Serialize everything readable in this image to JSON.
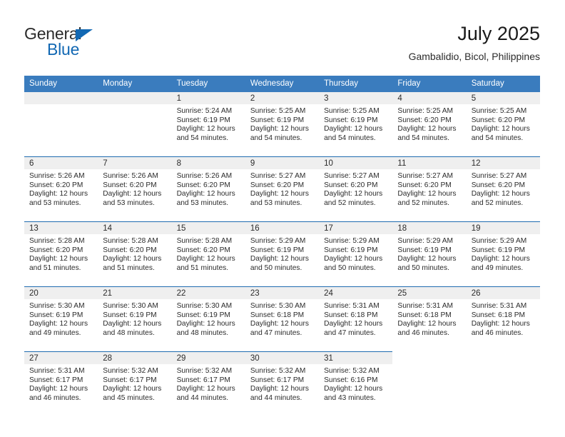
{
  "brand": {
    "word_one": "General",
    "word_two": "Blue",
    "triangle_icon": "triangle-right-icon",
    "color": "#1268b3"
  },
  "header": {
    "title": "July 2025",
    "subtitle": "Gambalidio, Bicol, Philippines"
  },
  "theme": {
    "header_blue": "#3a7cbe",
    "row_divider_blue": "#1f6cb0",
    "daynum_band_gray": "#efefef",
    "text_color": "#2b2b2b"
  },
  "calendar": {
    "weekday_headers": [
      "Sunday",
      "Monday",
      "Tuesday",
      "Wednesday",
      "Thursday",
      "Friday",
      "Saturday"
    ],
    "weeks": [
      [
        {
          "day": "",
          "empty": true
        },
        {
          "day": "",
          "empty": true
        },
        {
          "day": "1",
          "sunrise": "Sunrise: 5:24 AM",
          "sunset": "Sunset: 6:19 PM",
          "daylight": "Daylight: 12 hours and 54 minutes."
        },
        {
          "day": "2",
          "sunrise": "Sunrise: 5:25 AM",
          "sunset": "Sunset: 6:19 PM",
          "daylight": "Daylight: 12 hours and 54 minutes."
        },
        {
          "day": "3",
          "sunrise": "Sunrise: 5:25 AM",
          "sunset": "Sunset: 6:19 PM",
          "daylight": "Daylight: 12 hours and 54 minutes."
        },
        {
          "day": "4",
          "sunrise": "Sunrise: 5:25 AM",
          "sunset": "Sunset: 6:20 PM",
          "daylight": "Daylight: 12 hours and 54 minutes."
        },
        {
          "day": "5",
          "sunrise": "Sunrise: 5:25 AM",
          "sunset": "Sunset: 6:20 PM",
          "daylight": "Daylight: 12 hours and 54 minutes."
        }
      ],
      [
        {
          "day": "6",
          "sunrise": "Sunrise: 5:26 AM",
          "sunset": "Sunset: 6:20 PM",
          "daylight": "Daylight: 12 hours and 53 minutes."
        },
        {
          "day": "7",
          "sunrise": "Sunrise: 5:26 AM",
          "sunset": "Sunset: 6:20 PM",
          "daylight": "Daylight: 12 hours and 53 minutes."
        },
        {
          "day": "8",
          "sunrise": "Sunrise: 5:26 AM",
          "sunset": "Sunset: 6:20 PM",
          "daylight": "Daylight: 12 hours and 53 minutes."
        },
        {
          "day": "9",
          "sunrise": "Sunrise: 5:27 AM",
          "sunset": "Sunset: 6:20 PM",
          "daylight": "Daylight: 12 hours and 53 minutes."
        },
        {
          "day": "10",
          "sunrise": "Sunrise: 5:27 AM",
          "sunset": "Sunset: 6:20 PM",
          "daylight": "Daylight: 12 hours and 52 minutes."
        },
        {
          "day": "11",
          "sunrise": "Sunrise: 5:27 AM",
          "sunset": "Sunset: 6:20 PM",
          "daylight": "Daylight: 12 hours and 52 minutes."
        },
        {
          "day": "12",
          "sunrise": "Sunrise: 5:27 AM",
          "sunset": "Sunset: 6:20 PM",
          "daylight": "Daylight: 12 hours and 52 minutes."
        }
      ],
      [
        {
          "day": "13",
          "sunrise": "Sunrise: 5:28 AM",
          "sunset": "Sunset: 6:20 PM",
          "daylight": "Daylight: 12 hours and 51 minutes."
        },
        {
          "day": "14",
          "sunrise": "Sunrise: 5:28 AM",
          "sunset": "Sunset: 6:20 PM",
          "daylight": "Daylight: 12 hours and 51 minutes."
        },
        {
          "day": "15",
          "sunrise": "Sunrise: 5:28 AM",
          "sunset": "Sunset: 6:20 PM",
          "daylight": "Daylight: 12 hours and 51 minutes."
        },
        {
          "day": "16",
          "sunrise": "Sunrise: 5:29 AM",
          "sunset": "Sunset: 6:19 PM",
          "daylight": "Daylight: 12 hours and 50 minutes."
        },
        {
          "day": "17",
          "sunrise": "Sunrise: 5:29 AM",
          "sunset": "Sunset: 6:19 PM",
          "daylight": "Daylight: 12 hours and 50 minutes."
        },
        {
          "day": "18",
          "sunrise": "Sunrise: 5:29 AM",
          "sunset": "Sunset: 6:19 PM",
          "daylight": "Daylight: 12 hours and 50 minutes."
        },
        {
          "day": "19",
          "sunrise": "Sunrise: 5:29 AM",
          "sunset": "Sunset: 6:19 PM",
          "daylight": "Daylight: 12 hours and 49 minutes."
        }
      ],
      [
        {
          "day": "20",
          "sunrise": "Sunrise: 5:30 AM",
          "sunset": "Sunset: 6:19 PM",
          "daylight": "Daylight: 12 hours and 49 minutes."
        },
        {
          "day": "21",
          "sunrise": "Sunrise: 5:30 AM",
          "sunset": "Sunset: 6:19 PM",
          "daylight": "Daylight: 12 hours and 48 minutes."
        },
        {
          "day": "22",
          "sunrise": "Sunrise: 5:30 AM",
          "sunset": "Sunset: 6:19 PM",
          "daylight": "Daylight: 12 hours and 48 minutes."
        },
        {
          "day": "23",
          "sunrise": "Sunrise: 5:30 AM",
          "sunset": "Sunset: 6:18 PM",
          "daylight": "Daylight: 12 hours and 47 minutes."
        },
        {
          "day": "24",
          "sunrise": "Sunrise: 5:31 AM",
          "sunset": "Sunset: 6:18 PM",
          "daylight": "Daylight: 12 hours and 47 minutes."
        },
        {
          "day": "25",
          "sunrise": "Sunrise: 5:31 AM",
          "sunset": "Sunset: 6:18 PM",
          "daylight": "Daylight: 12 hours and 46 minutes."
        },
        {
          "day": "26",
          "sunrise": "Sunrise: 5:31 AM",
          "sunset": "Sunset: 6:18 PM",
          "daylight": "Daylight: 12 hours and 46 minutes."
        }
      ],
      [
        {
          "day": "27",
          "sunrise": "Sunrise: 5:31 AM",
          "sunset": "Sunset: 6:17 PM",
          "daylight": "Daylight: 12 hours and 46 minutes."
        },
        {
          "day": "28",
          "sunrise": "Sunrise: 5:32 AM",
          "sunset": "Sunset: 6:17 PM",
          "daylight": "Daylight: 12 hours and 45 minutes."
        },
        {
          "day": "29",
          "sunrise": "Sunrise: 5:32 AM",
          "sunset": "Sunset: 6:17 PM",
          "daylight": "Daylight: 12 hours and 44 minutes."
        },
        {
          "day": "30",
          "sunrise": "Sunrise: 5:32 AM",
          "sunset": "Sunset: 6:17 PM",
          "daylight": "Daylight: 12 hours and 44 minutes."
        },
        {
          "day": "31",
          "sunrise": "Sunrise: 5:32 AM",
          "sunset": "Sunset: 6:16 PM",
          "daylight": "Daylight: 12 hours and 43 minutes."
        },
        {
          "day": "",
          "empty": true,
          "blank": true
        },
        {
          "day": "",
          "empty": true,
          "blank": true
        }
      ]
    ]
  }
}
